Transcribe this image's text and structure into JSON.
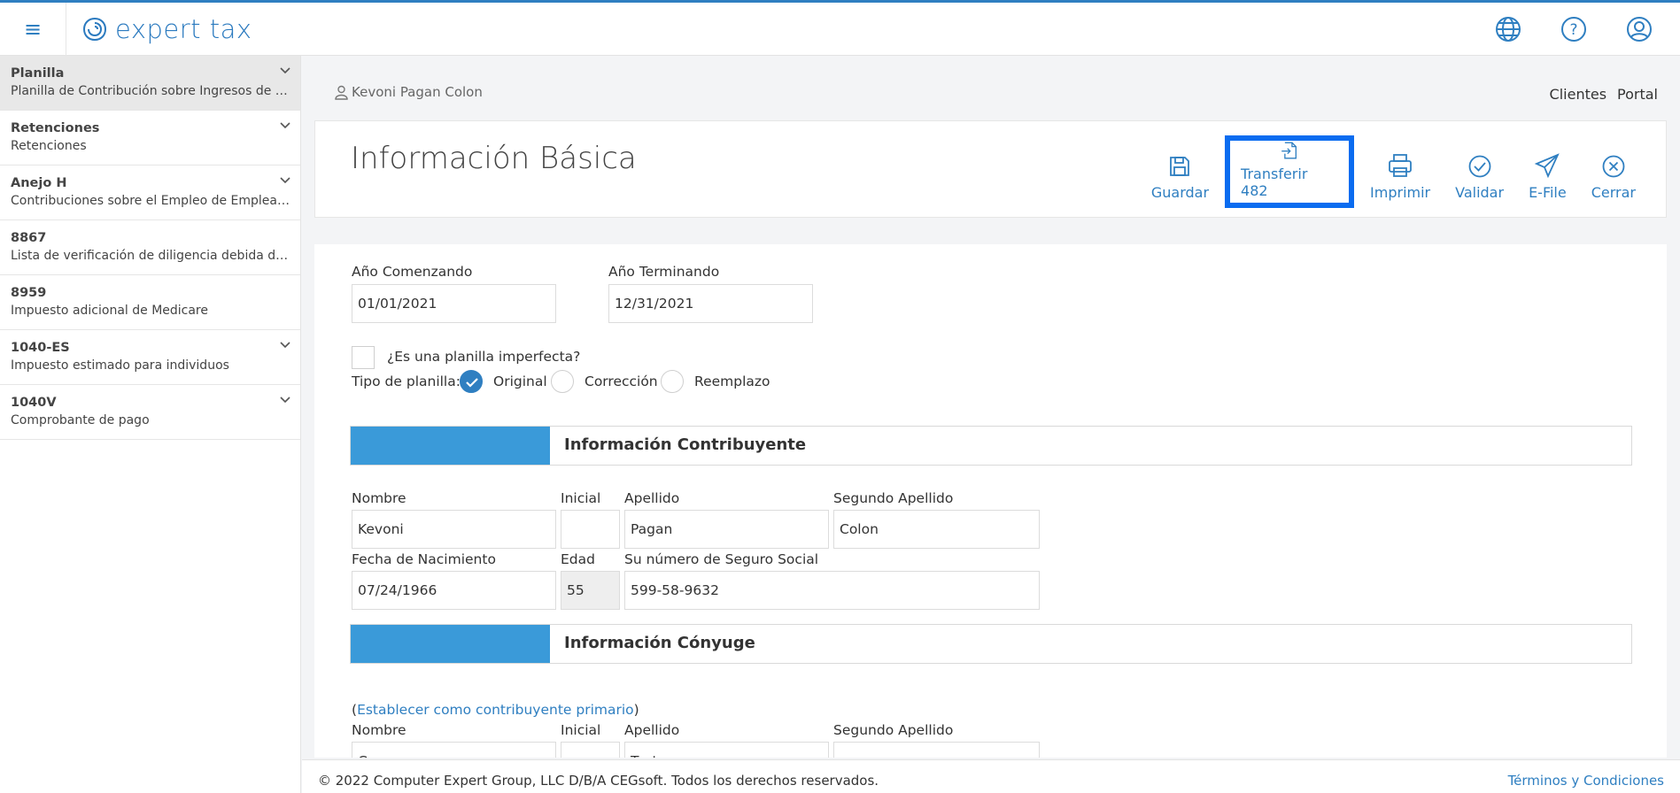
{
  "app": {
    "brand": "expert tax"
  },
  "colors": {
    "accent": "#2f7fc1",
    "section_bar": "#3a9ad9",
    "highlight": "#0a6cf0"
  },
  "sidebar": {
    "items": [
      {
        "title": "Planilla",
        "subtitle": "Planilla de Contribución sobre Ingresos de Individuos",
        "expandable": true,
        "active": true
      },
      {
        "title": "Retenciones",
        "subtitle": "Retenciones",
        "expandable": true
      },
      {
        "title": "Anejo H",
        "subtitle": "Contribuciones sobre el Empleo de Empleados Domésticos",
        "expandable": true
      },
      {
        "title": "8867",
        "subtitle": "Lista de verificación de diligencia debida del preparador",
        "expandable": false
      },
      {
        "title": "8959",
        "subtitle": "Impuesto adicional de Medicare",
        "expandable": false
      },
      {
        "title": "1040-ES",
        "subtitle": "Impuesto estimado para individuos",
        "expandable": true
      },
      {
        "title": "1040V",
        "subtitle": "Comprobante de pago",
        "expandable": true
      }
    ]
  },
  "client": {
    "name": "Kevoni Pagan Colon"
  },
  "header_links": {
    "clients": "Clientes",
    "portal": "Portal"
  },
  "page": {
    "title": "Información Básica"
  },
  "toolbar": {
    "save": "Guardar",
    "transfer": "Transferir 482",
    "print": "Imprimir",
    "validate": "Validar",
    "efile": "E-File",
    "close": "Cerrar"
  },
  "form": {
    "year_start_label": "Año Comenzando",
    "year_start": "01/01/2021",
    "year_end_label": "Año Terminando",
    "year_end": "12/31/2021",
    "imperfect_label": "¿Es una planilla imperfecta?",
    "type_label": "Tipo de planilla:",
    "type_options": [
      "Original",
      "Corrección",
      "Reemplazo"
    ],
    "taxpayer_section": "Información Contribuyente",
    "spouse_section": "Información Cónyuge",
    "labels": {
      "first": "Nombre",
      "initial": "Inicial",
      "last": "Apellido",
      "second_last": "Segundo Apellido",
      "dob": "Fecha de Nacimiento",
      "age": "Edad",
      "ssn": "Su número de Seguro Social"
    },
    "taxpayer": {
      "first": "Kevoni",
      "initial": "",
      "last": "Pagan",
      "second_last": "Colon",
      "dob": "07/24/1966",
      "age": "55",
      "ssn": "599-58-9632"
    },
    "set_primary": "Establecer como contribuyente primario",
    "spouse": {
      "first": "Conyuge",
      "initial": "",
      "last": "Test",
      "second_last": ""
    }
  },
  "footer": {
    "copyright": "© 2022 Computer Expert Group, LLC D/B/A CEGsoft. Todos los derechos reservados.",
    "terms": "Términos y Condiciones"
  }
}
